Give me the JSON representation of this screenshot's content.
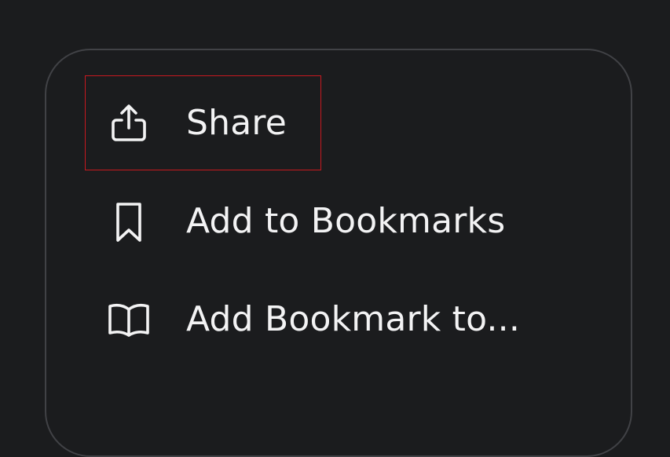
{
  "menu": {
    "items": [
      {
        "label": "Share",
        "icon": "share-icon"
      },
      {
        "label": "Add to Bookmarks",
        "icon": "bookmark-icon"
      },
      {
        "label": "Add Bookmark to...",
        "icon": "book-icon"
      }
    ]
  },
  "colors": {
    "background": "#1b1c1e",
    "card_border": "#414246",
    "text": "#f3f3f4",
    "focus_outline": "#c8191f"
  }
}
